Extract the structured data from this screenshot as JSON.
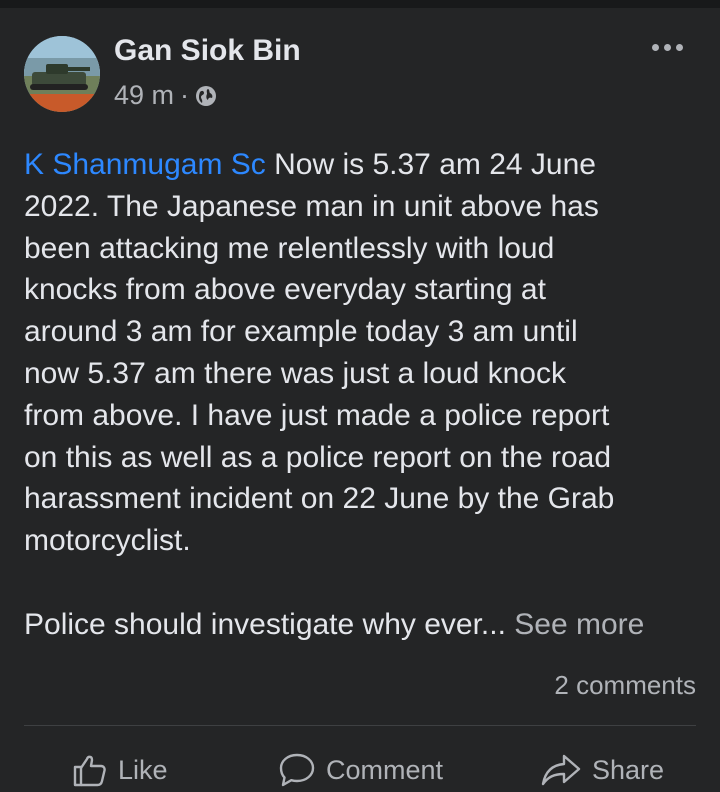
{
  "post": {
    "author": "Gan Siok Bin",
    "time": "49 m",
    "separator": "·",
    "privacy_icon": "globe-icon",
    "more_icon": "more-horizontal-icon",
    "mention": "K Shanmugam Sc",
    "lines": [
      " Now is 5.37 am 24 June",
      "2022. The Japanese man  in unit above has",
      "been attacking me relentlessly with loud",
      "knocks from above everyday starting at",
      "around 3 am for example today 3 am until",
      "now 5.37 am there was just a loud knock",
      "from above. I have just made a police report",
      "on this as well as a police report on the road",
      "harassment incident on 22 June by the Grab",
      "motorcyclist."
    ],
    "truncated_line": "Police should investigate why ever... ",
    "see_more": "See more",
    "comments_count": "2 comments"
  },
  "actions": {
    "like": "Like",
    "comment": "Comment",
    "share": "Share"
  },
  "colors": {
    "background": "#242526",
    "text": "#e4e6eb",
    "secondary": "#b0b3b8",
    "mention": "#2d88ff"
  }
}
